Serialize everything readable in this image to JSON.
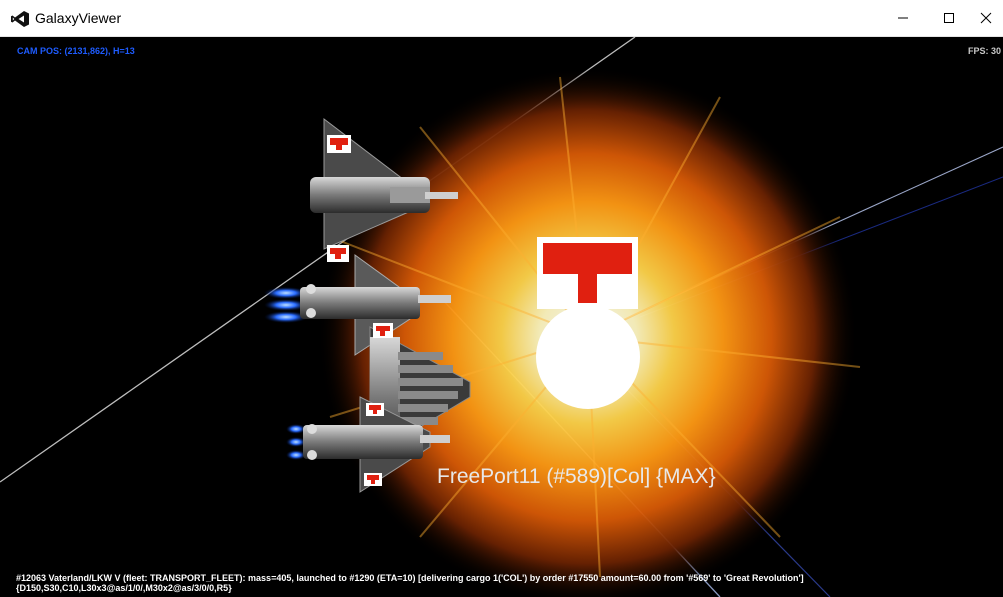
{
  "window": {
    "title": "GalaxyViewer",
    "controls": {
      "minimize": "minimize-icon",
      "maximize": "maximize-icon",
      "close": "close-icon"
    }
  },
  "hud": {
    "cam_pos": "CAM POS: (2131,862), H=13",
    "fps": "FPS: 30"
  },
  "planet": {
    "label": "FreePort11 (#589)[Col] {MAX}",
    "flag": "flag-icon"
  },
  "status": {
    "line1": "#12063 Vaterland/LKW V (fleet: TRANSPORT_FLEET): mass=405, launched to #1290 (ETA=10) [delivering cargo 1('COL') by order #17550 amount=60.00 from '#569' to 'Great Revolution']",
    "line2": "{D150,S30,C10,L30x3@as/1/0/,M30x2@as/3/0/0,R5}"
  },
  "colors": {
    "cam_text": "#1e5cff",
    "fps_text": "#c8c8c8",
    "flag_red": "#e02010",
    "engine_glow": "#2a6cff"
  }
}
